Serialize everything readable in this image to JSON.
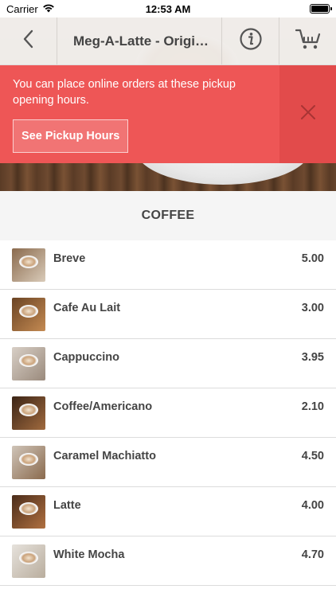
{
  "status_bar": {
    "carrier": "Carrier",
    "time": "12:53 AM"
  },
  "nav": {
    "title": "Meg-A-Latte - Origi…"
  },
  "banner": {
    "message": "You can place online orders at these pickup opening hours.",
    "button_label": "See Pickup Hours"
  },
  "section": {
    "title": "COFFEE"
  },
  "items": [
    {
      "name": "Breve",
      "price": "5.00"
    },
    {
      "name": "Cafe Au Lait",
      "price": "3.00"
    },
    {
      "name": "Cappuccino",
      "price": "3.95"
    },
    {
      "name": "Coffee/Americano",
      "price": "2.10"
    },
    {
      "name": "Caramel Machiatto",
      "price": "4.50"
    },
    {
      "name": "Latte",
      "price": "4.00"
    },
    {
      "name": "White Mocha",
      "price": "4.70"
    }
  ],
  "colors": {
    "banner": "#ee5656",
    "banner_close": "#e24b4b",
    "section_bg": "#f5f5f5"
  },
  "icons": {
    "back": "chevron-left-icon",
    "info": "info-icon",
    "cart": "cart-icon",
    "close": "close-icon",
    "wifi": "wifi-icon",
    "battery": "battery-icon"
  }
}
